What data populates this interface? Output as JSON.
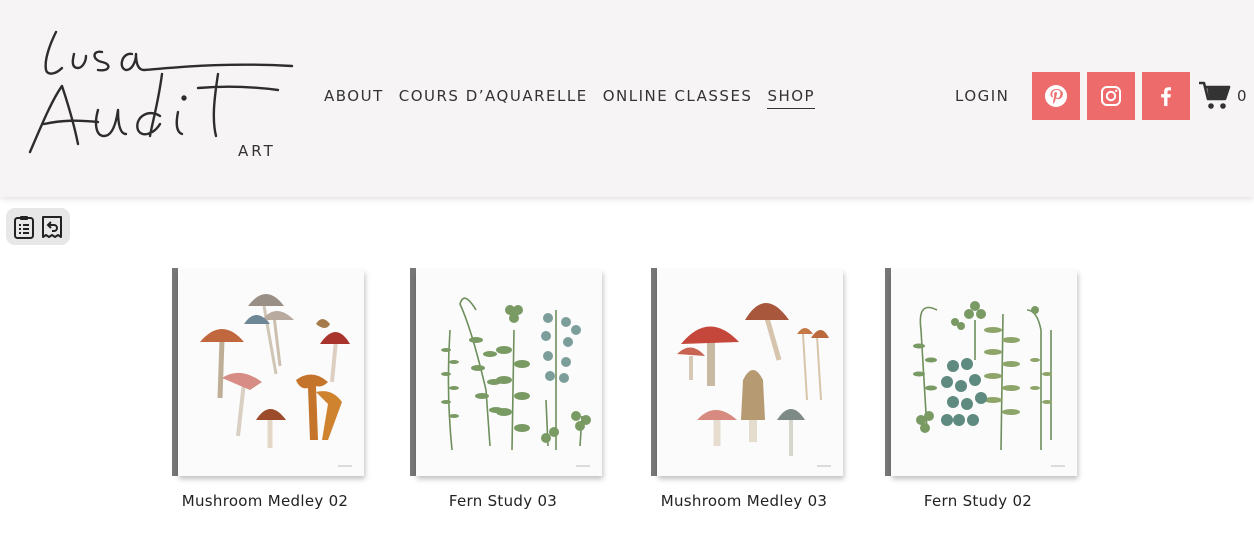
{
  "brand": {
    "script": "Lisa Audit",
    "sub": "ART"
  },
  "nav": {
    "items": [
      {
        "label": "ABOUT"
      },
      {
        "label": "COURS D’AQUARELLE"
      },
      {
        "label": "ONLINE CLASSES"
      },
      {
        "label": "SHOP",
        "active": true
      }
    ],
    "login": "LOGIN",
    "cart_count": "0"
  },
  "social": [
    {
      "icon": "pinterest-icon"
    },
    {
      "icon": "instagram-icon"
    },
    {
      "icon": "facebook-icon"
    }
  ],
  "colors": {
    "accent": "#ee6b6b",
    "header_bg": "#f6f4f5"
  },
  "products": [
    {
      "title": "Mushroom Medley 02"
    },
    {
      "title": "Fern Study 03"
    },
    {
      "title": "Mushroom Medley 03"
    },
    {
      "title": "Fern Study 02"
    }
  ]
}
